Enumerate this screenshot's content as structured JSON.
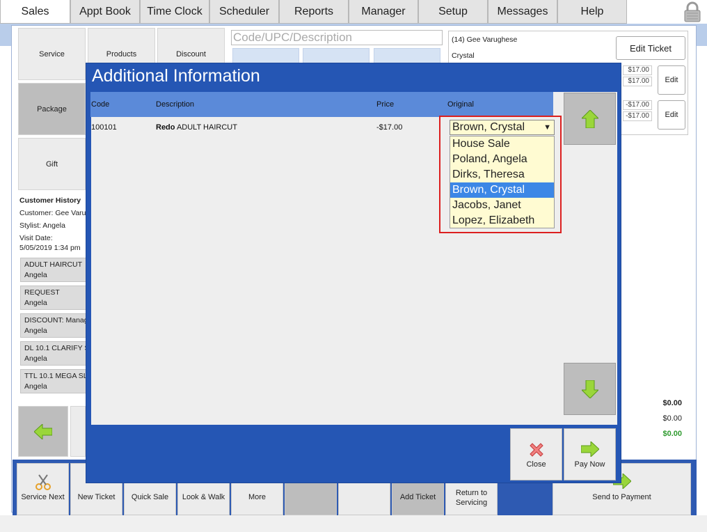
{
  "nav": {
    "tabs": [
      "Sales",
      "Appt Book",
      "Time Clock",
      "Scheduler",
      "Reports",
      "Manager",
      "Setup",
      "Messages",
      "Help"
    ],
    "active": "Sales"
  },
  "left_tiles": {
    "service": "Service",
    "products": "Products",
    "discount": "Discount",
    "package": "Package",
    "gift": "Gift"
  },
  "search": {
    "placeholder": "Code/UPC/Description"
  },
  "history": {
    "title": "Customer History",
    "customer": "Customer: Gee Varu",
    "stylist": "Stylist: Angela",
    "visit_label": "Visit Date:",
    "visit_value": "5/05/2019 1:34 pm",
    "items": [
      {
        "service": "ADULT HAIRCUT",
        "stylist": "Angela"
      },
      {
        "service": "REQUEST",
        "stylist": "Angela"
      },
      {
        "service": "DISCOUNT: Manag",
        "stylist": "Angela"
      },
      {
        "service": "DL 10.1 CLARIFY S",
        "stylist": "Angela"
      },
      {
        "service": "TTL 10.1 MEGA SLE",
        "stylist": "Angela"
      }
    ]
  },
  "ticket": {
    "customer": "(14) Gee Varughese",
    "stylist": "Crystal",
    "edit_ticket": "Edit Ticket",
    "edit": "Edit",
    "amounts1": [
      "$17.00",
      "$17.00"
    ],
    "amounts2": [
      "-$17.00",
      "-$17.00"
    ]
  },
  "totals": [
    "$0.00",
    "$0.00",
    "$0.00"
  ],
  "modal": {
    "title": "Additional Information",
    "columns": {
      "code": "Code",
      "description": "Description",
      "price": "Price",
      "original": "Original"
    },
    "row": {
      "code": "100101",
      "desc_bold": "Redo",
      "desc": " ADULT HAIRCUT",
      "price": "-$17.00"
    },
    "dropdown": {
      "selected": "Brown, Crystal",
      "options": [
        "House Sale",
        "Poland, Angela",
        "Dirks, Theresa",
        "Brown, Crystal",
        "Jacobs, Janet",
        "Lopez, Elizabeth"
      ],
      "highlighted_index": 3
    },
    "close": "Close",
    "pay_now": "Pay Now"
  },
  "toolbar": {
    "service_next": "Service Next",
    "new_ticket": "New Ticket",
    "quick_sale": "Quick Sale",
    "look_walk": "Look & Walk",
    "more": "More",
    "add_ticket": "Add Ticket",
    "return_servicing": "Return to Servicing",
    "send_payment": "Send to Payment"
  },
  "colors": {
    "modal_blue": "#2556b4",
    "grid_header": "#5b8ad9",
    "highlight": "#3c87e6",
    "red_outline": "#dc1f1f",
    "dropdown_bg": "#fffbd2"
  }
}
